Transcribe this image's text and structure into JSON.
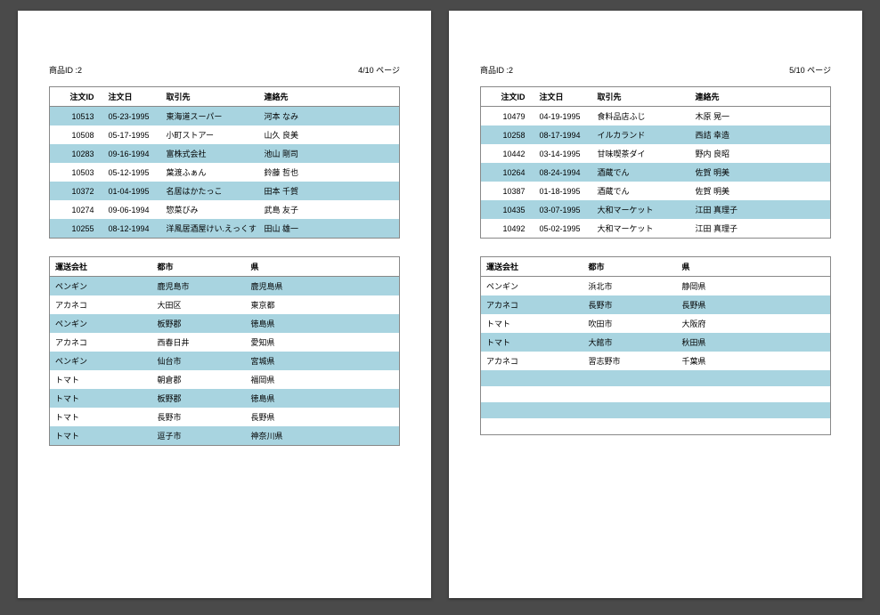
{
  "pages": [
    {
      "product_label": "商品ID :2",
      "page_label": "4/10 ページ",
      "table1": {
        "headers": [
          "注文ID",
          "注文日",
          "取引先",
          "連絡先"
        ],
        "rows": [
          {
            "shade": true,
            "c": [
              "10513",
              "05-23-1995",
              "東海道スーパー",
              "河本 なみ"
            ]
          },
          {
            "shade": false,
            "c": [
              "10508",
              "05-17-1995",
              "小町ストアー",
              "山久 良美"
            ]
          },
          {
            "shade": true,
            "c": [
              "10283",
              "09-16-1994",
              "富株式会社",
              "池山 剛司"
            ]
          },
          {
            "shade": false,
            "c": [
              "10503",
              "05-12-1995",
              "葉渡ふぁん",
              "鈴藤 哲也"
            ]
          },
          {
            "shade": true,
            "c": [
              "10372",
              "01-04-1995",
              "名居はかたっこ",
              "田本 千賀"
            ]
          },
          {
            "shade": false,
            "c": [
              "10274",
              "09-06-1994",
              "惣菜びみ",
              "武島 友子"
            ]
          },
          {
            "shade": true,
            "c": [
              "10255",
              "08-12-1994",
              "洋風居酒屋けい.えっくす",
              "田山 雄一"
            ]
          }
        ]
      },
      "table2": {
        "headers": [
          "運送会社",
          "都市",
          "県"
        ],
        "rows": [
          {
            "shade": true,
            "c": [
              "ペンギン",
              "鹿児島市",
              "鹿児島県"
            ]
          },
          {
            "shade": false,
            "c": [
              "アカネコ",
              "大田区",
              "東京都"
            ]
          },
          {
            "shade": true,
            "c": [
              "ペンギン",
              "板野郡",
              "徳島県"
            ]
          },
          {
            "shade": false,
            "c": [
              "アカネコ",
              "西春日井",
              "愛知県"
            ]
          },
          {
            "shade": true,
            "c": [
              "ペンギン",
              "仙台市",
              "宮城県"
            ]
          },
          {
            "shade": false,
            "c": [
              "トマト",
              "朝倉郡",
              "福岡県"
            ]
          },
          {
            "shade": true,
            "c": [
              "トマト",
              "板野郡",
              "徳島県"
            ]
          },
          {
            "shade": false,
            "c": [
              "トマト",
              "長野市",
              "長野県"
            ]
          },
          {
            "shade": true,
            "c": [
              "トマト",
              "逗子市",
              "神奈川県"
            ]
          }
        ]
      }
    },
    {
      "product_label": "商品ID :2",
      "page_label": "5/10 ページ",
      "table1": {
        "headers": [
          "注文ID",
          "注文日",
          "取引先",
          "連絡先"
        ],
        "rows": [
          {
            "shade": false,
            "c": [
              "10479",
              "04-19-1995",
              "食料品店ふじ",
              "木原 晃一"
            ]
          },
          {
            "shade": true,
            "c": [
              "10258",
              "08-17-1994",
              "イルカランド",
              "西詰 幸造"
            ]
          },
          {
            "shade": false,
            "c": [
              "10442",
              "03-14-1995",
              "甘味喫茶ダイ",
              "野内 良昭"
            ]
          },
          {
            "shade": true,
            "c": [
              "10264",
              "08-24-1994",
              "酒蔵でん",
              "佐賀 明美"
            ]
          },
          {
            "shade": false,
            "c": [
              "10387",
              "01-18-1995",
              "酒蔵でん",
              "佐賀 明美"
            ]
          },
          {
            "shade": true,
            "c": [
              "10435",
              "03-07-1995",
              "大和マーケット",
              "江田 真理子"
            ]
          },
          {
            "shade": false,
            "c": [
              "10492",
              "05-02-1995",
              "大和マーケット",
              "江田 真理子"
            ]
          }
        ]
      },
      "table2": {
        "headers": [
          "運送会社",
          "都市",
          "県"
        ],
        "rows": [
          {
            "shade": false,
            "c": [
              "ペンギン",
              "浜北市",
              "静岡県"
            ]
          },
          {
            "shade": true,
            "c": [
              "アカネコ",
              "長野市",
              "長野県"
            ]
          },
          {
            "shade": false,
            "c": [
              "トマト",
              "吹田市",
              "大阪府"
            ]
          },
          {
            "shade": true,
            "c": [
              "トマト",
              "大館市",
              "秋田県"
            ]
          },
          {
            "shade": false,
            "c": [
              "アカネコ",
              "習志野市",
              "千葉県"
            ]
          },
          {
            "shade": true,
            "c": [
              "",
              "",
              ""
            ]
          },
          {
            "shade": false,
            "c": [
              "",
              "",
              ""
            ]
          },
          {
            "shade": true,
            "c": [
              "",
              "",
              ""
            ]
          },
          {
            "shade": false,
            "c": [
              "",
              "",
              ""
            ]
          }
        ]
      }
    }
  ]
}
